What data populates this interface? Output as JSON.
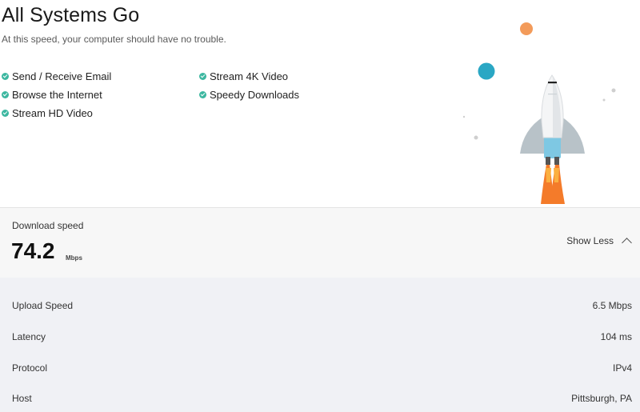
{
  "hero": {
    "title": "All Systems Go",
    "subtitle": "At this speed, your computer should have no trouble.",
    "capabilities": [
      "Send / Receive Email",
      "Browse the Internet",
      "Stream HD Video",
      "Stream 4K Video",
      "Speedy Downloads"
    ]
  },
  "download": {
    "label": "Download speed",
    "value": "74.2",
    "unit": "Mbps",
    "toggle_label": "Show Less"
  },
  "details": {
    "rows": [
      {
        "label": "Upload Speed",
        "value": "6.5 Mbps"
      },
      {
        "label": "Latency",
        "value": "104 ms"
      },
      {
        "label": "Protocol",
        "value": "IPv4"
      },
      {
        "label": "Host",
        "value": "Pittsburgh, PA"
      }
    ]
  },
  "colors": {
    "check": "#3cb7a0",
    "bubble_orange": "#f39b5a",
    "bubble_teal": "#2aa7c4",
    "flame": "#f47b2a",
    "details_bg": "#f0f1f5"
  }
}
